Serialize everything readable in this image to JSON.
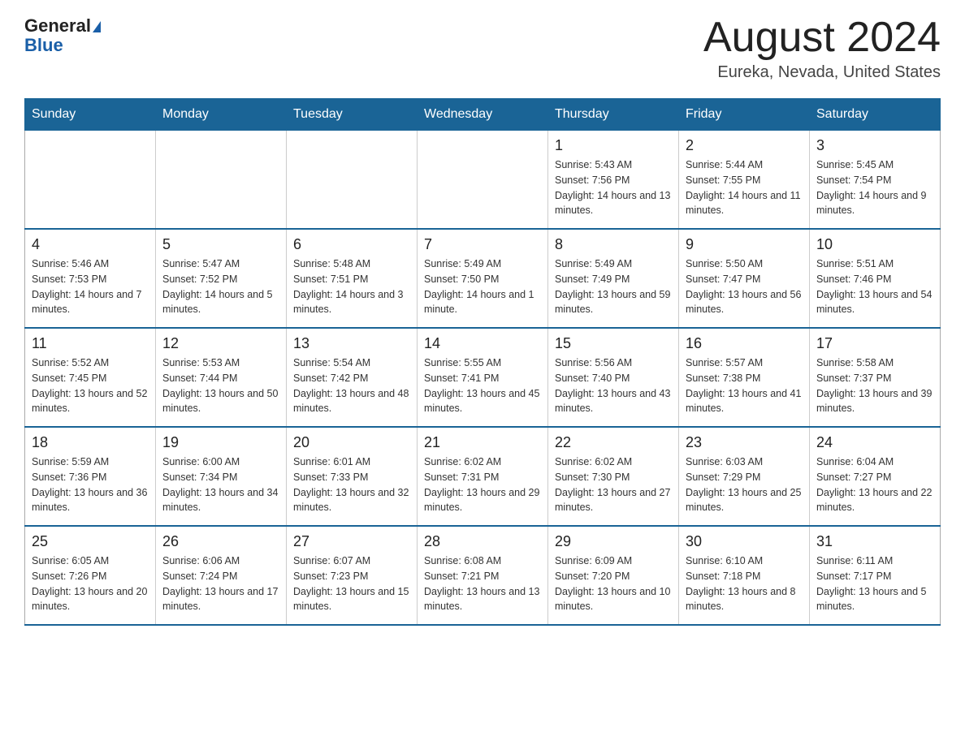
{
  "logo": {
    "general": "General",
    "blue": "Blue"
  },
  "header": {
    "month_title": "August 2024",
    "location": "Eureka, Nevada, United States"
  },
  "weekdays": [
    "Sunday",
    "Monday",
    "Tuesday",
    "Wednesday",
    "Thursday",
    "Friday",
    "Saturday"
  ],
  "weeks": [
    [
      {
        "day": "",
        "info": ""
      },
      {
        "day": "",
        "info": ""
      },
      {
        "day": "",
        "info": ""
      },
      {
        "day": "",
        "info": ""
      },
      {
        "day": "1",
        "info": "Sunrise: 5:43 AM\nSunset: 7:56 PM\nDaylight: 14 hours and 13 minutes."
      },
      {
        "day": "2",
        "info": "Sunrise: 5:44 AM\nSunset: 7:55 PM\nDaylight: 14 hours and 11 minutes."
      },
      {
        "day": "3",
        "info": "Sunrise: 5:45 AM\nSunset: 7:54 PM\nDaylight: 14 hours and 9 minutes."
      }
    ],
    [
      {
        "day": "4",
        "info": "Sunrise: 5:46 AM\nSunset: 7:53 PM\nDaylight: 14 hours and 7 minutes."
      },
      {
        "day": "5",
        "info": "Sunrise: 5:47 AM\nSunset: 7:52 PM\nDaylight: 14 hours and 5 minutes."
      },
      {
        "day": "6",
        "info": "Sunrise: 5:48 AM\nSunset: 7:51 PM\nDaylight: 14 hours and 3 minutes."
      },
      {
        "day": "7",
        "info": "Sunrise: 5:49 AM\nSunset: 7:50 PM\nDaylight: 14 hours and 1 minute."
      },
      {
        "day": "8",
        "info": "Sunrise: 5:49 AM\nSunset: 7:49 PM\nDaylight: 13 hours and 59 minutes."
      },
      {
        "day": "9",
        "info": "Sunrise: 5:50 AM\nSunset: 7:47 PM\nDaylight: 13 hours and 56 minutes."
      },
      {
        "day": "10",
        "info": "Sunrise: 5:51 AM\nSunset: 7:46 PM\nDaylight: 13 hours and 54 minutes."
      }
    ],
    [
      {
        "day": "11",
        "info": "Sunrise: 5:52 AM\nSunset: 7:45 PM\nDaylight: 13 hours and 52 minutes."
      },
      {
        "day": "12",
        "info": "Sunrise: 5:53 AM\nSunset: 7:44 PM\nDaylight: 13 hours and 50 minutes."
      },
      {
        "day": "13",
        "info": "Sunrise: 5:54 AM\nSunset: 7:42 PM\nDaylight: 13 hours and 48 minutes."
      },
      {
        "day": "14",
        "info": "Sunrise: 5:55 AM\nSunset: 7:41 PM\nDaylight: 13 hours and 45 minutes."
      },
      {
        "day": "15",
        "info": "Sunrise: 5:56 AM\nSunset: 7:40 PM\nDaylight: 13 hours and 43 minutes."
      },
      {
        "day": "16",
        "info": "Sunrise: 5:57 AM\nSunset: 7:38 PM\nDaylight: 13 hours and 41 minutes."
      },
      {
        "day": "17",
        "info": "Sunrise: 5:58 AM\nSunset: 7:37 PM\nDaylight: 13 hours and 39 minutes."
      }
    ],
    [
      {
        "day": "18",
        "info": "Sunrise: 5:59 AM\nSunset: 7:36 PM\nDaylight: 13 hours and 36 minutes."
      },
      {
        "day": "19",
        "info": "Sunrise: 6:00 AM\nSunset: 7:34 PM\nDaylight: 13 hours and 34 minutes."
      },
      {
        "day": "20",
        "info": "Sunrise: 6:01 AM\nSunset: 7:33 PM\nDaylight: 13 hours and 32 minutes."
      },
      {
        "day": "21",
        "info": "Sunrise: 6:02 AM\nSunset: 7:31 PM\nDaylight: 13 hours and 29 minutes."
      },
      {
        "day": "22",
        "info": "Sunrise: 6:02 AM\nSunset: 7:30 PM\nDaylight: 13 hours and 27 minutes."
      },
      {
        "day": "23",
        "info": "Sunrise: 6:03 AM\nSunset: 7:29 PM\nDaylight: 13 hours and 25 minutes."
      },
      {
        "day": "24",
        "info": "Sunrise: 6:04 AM\nSunset: 7:27 PM\nDaylight: 13 hours and 22 minutes."
      }
    ],
    [
      {
        "day": "25",
        "info": "Sunrise: 6:05 AM\nSunset: 7:26 PM\nDaylight: 13 hours and 20 minutes."
      },
      {
        "day": "26",
        "info": "Sunrise: 6:06 AM\nSunset: 7:24 PM\nDaylight: 13 hours and 17 minutes."
      },
      {
        "day": "27",
        "info": "Sunrise: 6:07 AM\nSunset: 7:23 PM\nDaylight: 13 hours and 15 minutes."
      },
      {
        "day": "28",
        "info": "Sunrise: 6:08 AM\nSunset: 7:21 PM\nDaylight: 13 hours and 13 minutes."
      },
      {
        "day": "29",
        "info": "Sunrise: 6:09 AM\nSunset: 7:20 PM\nDaylight: 13 hours and 10 minutes."
      },
      {
        "day": "30",
        "info": "Sunrise: 6:10 AM\nSunset: 7:18 PM\nDaylight: 13 hours and 8 minutes."
      },
      {
        "day": "31",
        "info": "Sunrise: 6:11 AM\nSunset: 7:17 PM\nDaylight: 13 hours and 5 minutes."
      }
    ]
  ]
}
